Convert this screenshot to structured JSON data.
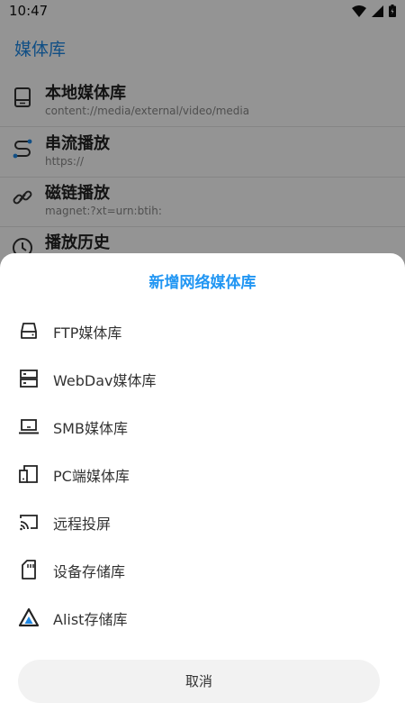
{
  "status": {
    "time": "10:47"
  },
  "appbar": {
    "title": "媒体库"
  },
  "libraries": [
    {
      "title": "本地媒体库",
      "sub": "content://media/external/video/media",
      "icon": "local-storage-icon"
    },
    {
      "title": "串流播放",
      "sub": "https://",
      "icon": "stream-icon"
    },
    {
      "title": "磁链播放",
      "sub": "magnet:?xt=urn:btih:",
      "icon": "magnet-link-icon"
    },
    {
      "title": "播放历史",
      "sub": "",
      "icon": "history-clock-icon"
    }
  ],
  "sheet": {
    "title": "新增网络媒体库",
    "options": [
      {
        "label": "FTP媒体库",
        "icon": "ftp-drive-icon"
      },
      {
        "label": "WebDav媒体库",
        "icon": "server-icon"
      },
      {
        "label": "SMB媒体库",
        "icon": "laptop-icon"
      },
      {
        "label": "PC端媒体库",
        "icon": "pc-device-icon"
      },
      {
        "label": "远程投屏",
        "icon": "cast-icon"
      },
      {
        "label": "设备存储库",
        "icon": "sd-card-icon"
      },
      {
        "label": "Alist存储库",
        "icon": "alist-icon"
      }
    ],
    "cancel_label": "取消"
  },
  "colors": {
    "accent": "#2196f3",
    "title_blue": "#1e88e5",
    "scrim": "rgba(0,0,0,0.42)"
  }
}
